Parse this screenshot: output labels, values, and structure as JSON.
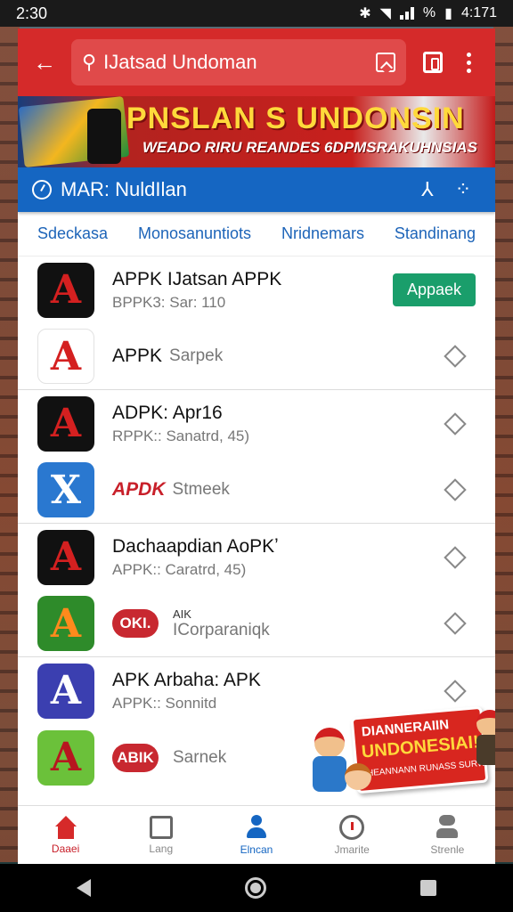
{
  "status_bar": {
    "time": "2:30",
    "right_text": "% ",
    "clock_right": "4:171"
  },
  "toolbar": {
    "back_glyph": "←",
    "search_text": "IJatsad Undoman"
  },
  "banner": {
    "title": "PNSLAN S UNDONSIN",
    "subtitle": "WEADO RIRU REANDES 6DPMSRAKUHNSIAS"
  },
  "blue_bar": {
    "title": "MAR: NuldIlan"
  },
  "tabs": [
    {
      "label": "Sdeckasa"
    },
    {
      "label": "Monosanuntiots"
    },
    {
      "label": "Nridnemars"
    },
    {
      "label": "Standinang"
    }
  ],
  "rows": [
    {
      "icon_glyph": "A",
      "title": "APPK IJatsan APPK",
      "subtitle": "BPPK3: Sar: 110",
      "action": "Appaek"
    },
    {
      "icon_glyph": "A",
      "title": "APPK",
      "subtitle": "Sarpek"
    },
    {
      "icon_glyph": "A",
      "title": "ADPK: Apr16",
      "subtitle": "RPPK:: Sanatrd, 45)"
    },
    {
      "icon_glyph": "X",
      "logo_text": "APDK",
      "subtitle": "Stmeek"
    },
    {
      "icon_glyph": "A",
      "title": "Dachaapdian AoPKʼ",
      "subtitle": "APPK:: Caratrd, 45)"
    },
    {
      "icon_glyph": "A",
      "logo_text": "OKI.",
      "small_text": "AIK",
      "subtitle": "ICorparaniqk"
    },
    {
      "icon_glyph": "A",
      "title": "APK Arbaha: APK",
      "subtitle": "APPK:: Sonnitd"
    },
    {
      "icon_glyph": "A",
      "logo_text": "ABIK",
      "subtitle": "Sarnek"
    }
  ],
  "promo": {
    "line1": "DIANNERAIIN",
    "line2": "UNDONESIAI!",
    "line3": "HEANNANN RUNASS SURWANAIN"
  },
  "bottom_nav": [
    {
      "label": "Daaei",
      "icon": "home-icon"
    },
    {
      "label": "Lang",
      "icon": "box-icon"
    },
    {
      "label": "Elncan",
      "icon": "person-icon"
    },
    {
      "label": "Jmarite",
      "icon": "timer-icon"
    },
    {
      "label": "Strenle",
      "icon": "user-icon"
    }
  ],
  "colors": {
    "toolbar": "#d52a2a",
    "blue_bar": "#1566c2",
    "accent_green": "#1a9e6b",
    "tab_text": "#1d64b8"
  }
}
